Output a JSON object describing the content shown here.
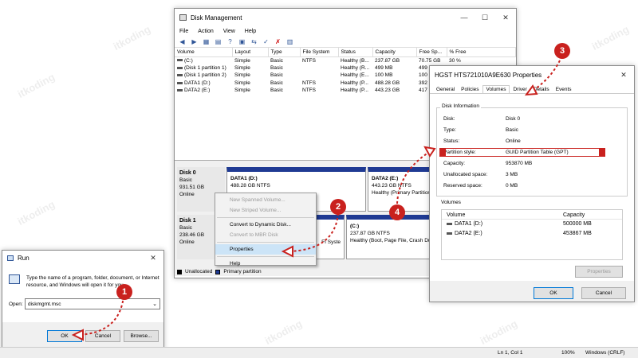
{
  "watermark": "itkoding",
  "disk_mgmt": {
    "title": "Disk Management",
    "menu": [
      "File",
      "Action",
      "View",
      "Help"
    ],
    "columns": [
      "Volume",
      "Layout",
      "Type",
      "File System",
      "Status",
      "Capacity",
      "Free Sp...",
      "% Free"
    ],
    "rows": [
      [
        "(C:)",
        "Simple",
        "Basic",
        "NTFS",
        "Healthy (B...",
        "237.87 GB",
        "70.75 GB",
        "30 %"
      ],
      [
        "(Disk 1 partition 1)",
        "Simple",
        "Basic",
        "",
        "Healthy (R...",
        "499 MB",
        "499",
        ""
      ],
      [
        "(Disk 1 partition 2)",
        "Simple",
        "Basic",
        "",
        "Healthy (E...",
        "100 MB",
        "100",
        ""
      ],
      [
        "DATA1 (D:)",
        "Simple",
        "Basic",
        "NTFS",
        "Healthy (P...",
        "488.28 GB",
        "392",
        ""
      ],
      [
        "DATA2 (E:)",
        "Simple",
        "Basic",
        "NTFS",
        "Healthy (P...",
        "443.23 GB",
        "417",
        ""
      ]
    ],
    "disk0": {
      "name": "Disk 0",
      "type": "Basic",
      "size": "931.51 GB",
      "status": "Online"
    },
    "disk0_p1": {
      "name": "DATA1  (D:)",
      "info": "488.28 GB NTFS"
    },
    "disk0_p2": {
      "name": "DATA2  (E:)",
      "info": "443.23 GB NTFS",
      "status": "Healthy (Primary Partition)"
    },
    "disk1": {
      "name": "Disk 1",
      "type": "Basic",
      "size": "238.46 GB",
      "status": "Online"
    },
    "disk1_p_mid": "FI Syste",
    "disk1_p_c": {
      "name": "(C:)",
      "info": "237.87 GB NTFS",
      "status": "Healthy (Boot, Page File, Crash Du"
    },
    "legend": {
      "unallocated": "Unallocated",
      "primary": "Primary partition"
    }
  },
  "context_menu": {
    "items": [
      {
        "label": "New Spanned Volume...",
        "disabled": true
      },
      {
        "label": "New Striped Volume...",
        "disabled": true
      },
      {
        "label": "Convert to Dynamic Disk...",
        "disabled": false
      },
      {
        "label": "Convert to MBR Disk",
        "disabled": true
      },
      {
        "label": "Properties",
        "disabled": false,
        "selected": true
      },
      {
        "label": "Help",
        "disabled": false
      }
    ]
  },
  "props": {
    "title": "HGST HTS721010A9E630 Properties",
    "tabs": [
      "General",
      "Policies",
      "Volumes",
      "Driver",
      "Details",
      "Events"
    ],
    "group_disk": "Disk Information",
    "fields": [
      {
        "k": "Disk:",
        "v": "Disk 0"
      },
      {
        "k": "Type:",
        "v": "Basic"
      },
      {
        "k": "Status:",
        "v": "Online"
      },
      {
        "k": "Partition style:",
        "v": "GUID Partition Table (GPT)"
      },
      {
        "k": "Capacity:",
        "v": "953870 MB"
      },
      {
        "k": "Unallocated space:",
        "v": "3 MB"
      },
      {
        "k": "Reserved space:",
        "v": "0 MB"
      }
    ],
    "group_volumes": "Volumes",
    "vol_cols": [
      "Volume",
      "Capacity"
    ],
    "vols": [
      {
        "name": "DATA1 (D:)",
        "cap": "500000 MB"
      },
      {
        "name": "DATA2 (E:)",
        "cap": "453867 MB"
      }
    ],
    "properties_btn": "Properties",
    "ok": "OK",
    "cancel": "Cancel"
  },
  "run": {
    "title": "Run",
    "desc": "Type the name of a program, folder, document, or Internet resource, and Windows will open it for you.",
    "open_label": "Open:",
    "value": "diskmgmt.msc",
    "ok": "OK",
    "cancel": "Cancel",
    "browse": "Browse..."
  },
  "callouts": [
    "1",
    "2",
    "3",
    "4"
  ],
  "statusbar": {
    "pos": "Ln 1, Col 1",
    "zoom": "100%",
    "eol": "Windows (CRLF)"
  },
  "colors": {
    "accent": "#c9211e",
    "partition": "#1f3a93"
  }
}
